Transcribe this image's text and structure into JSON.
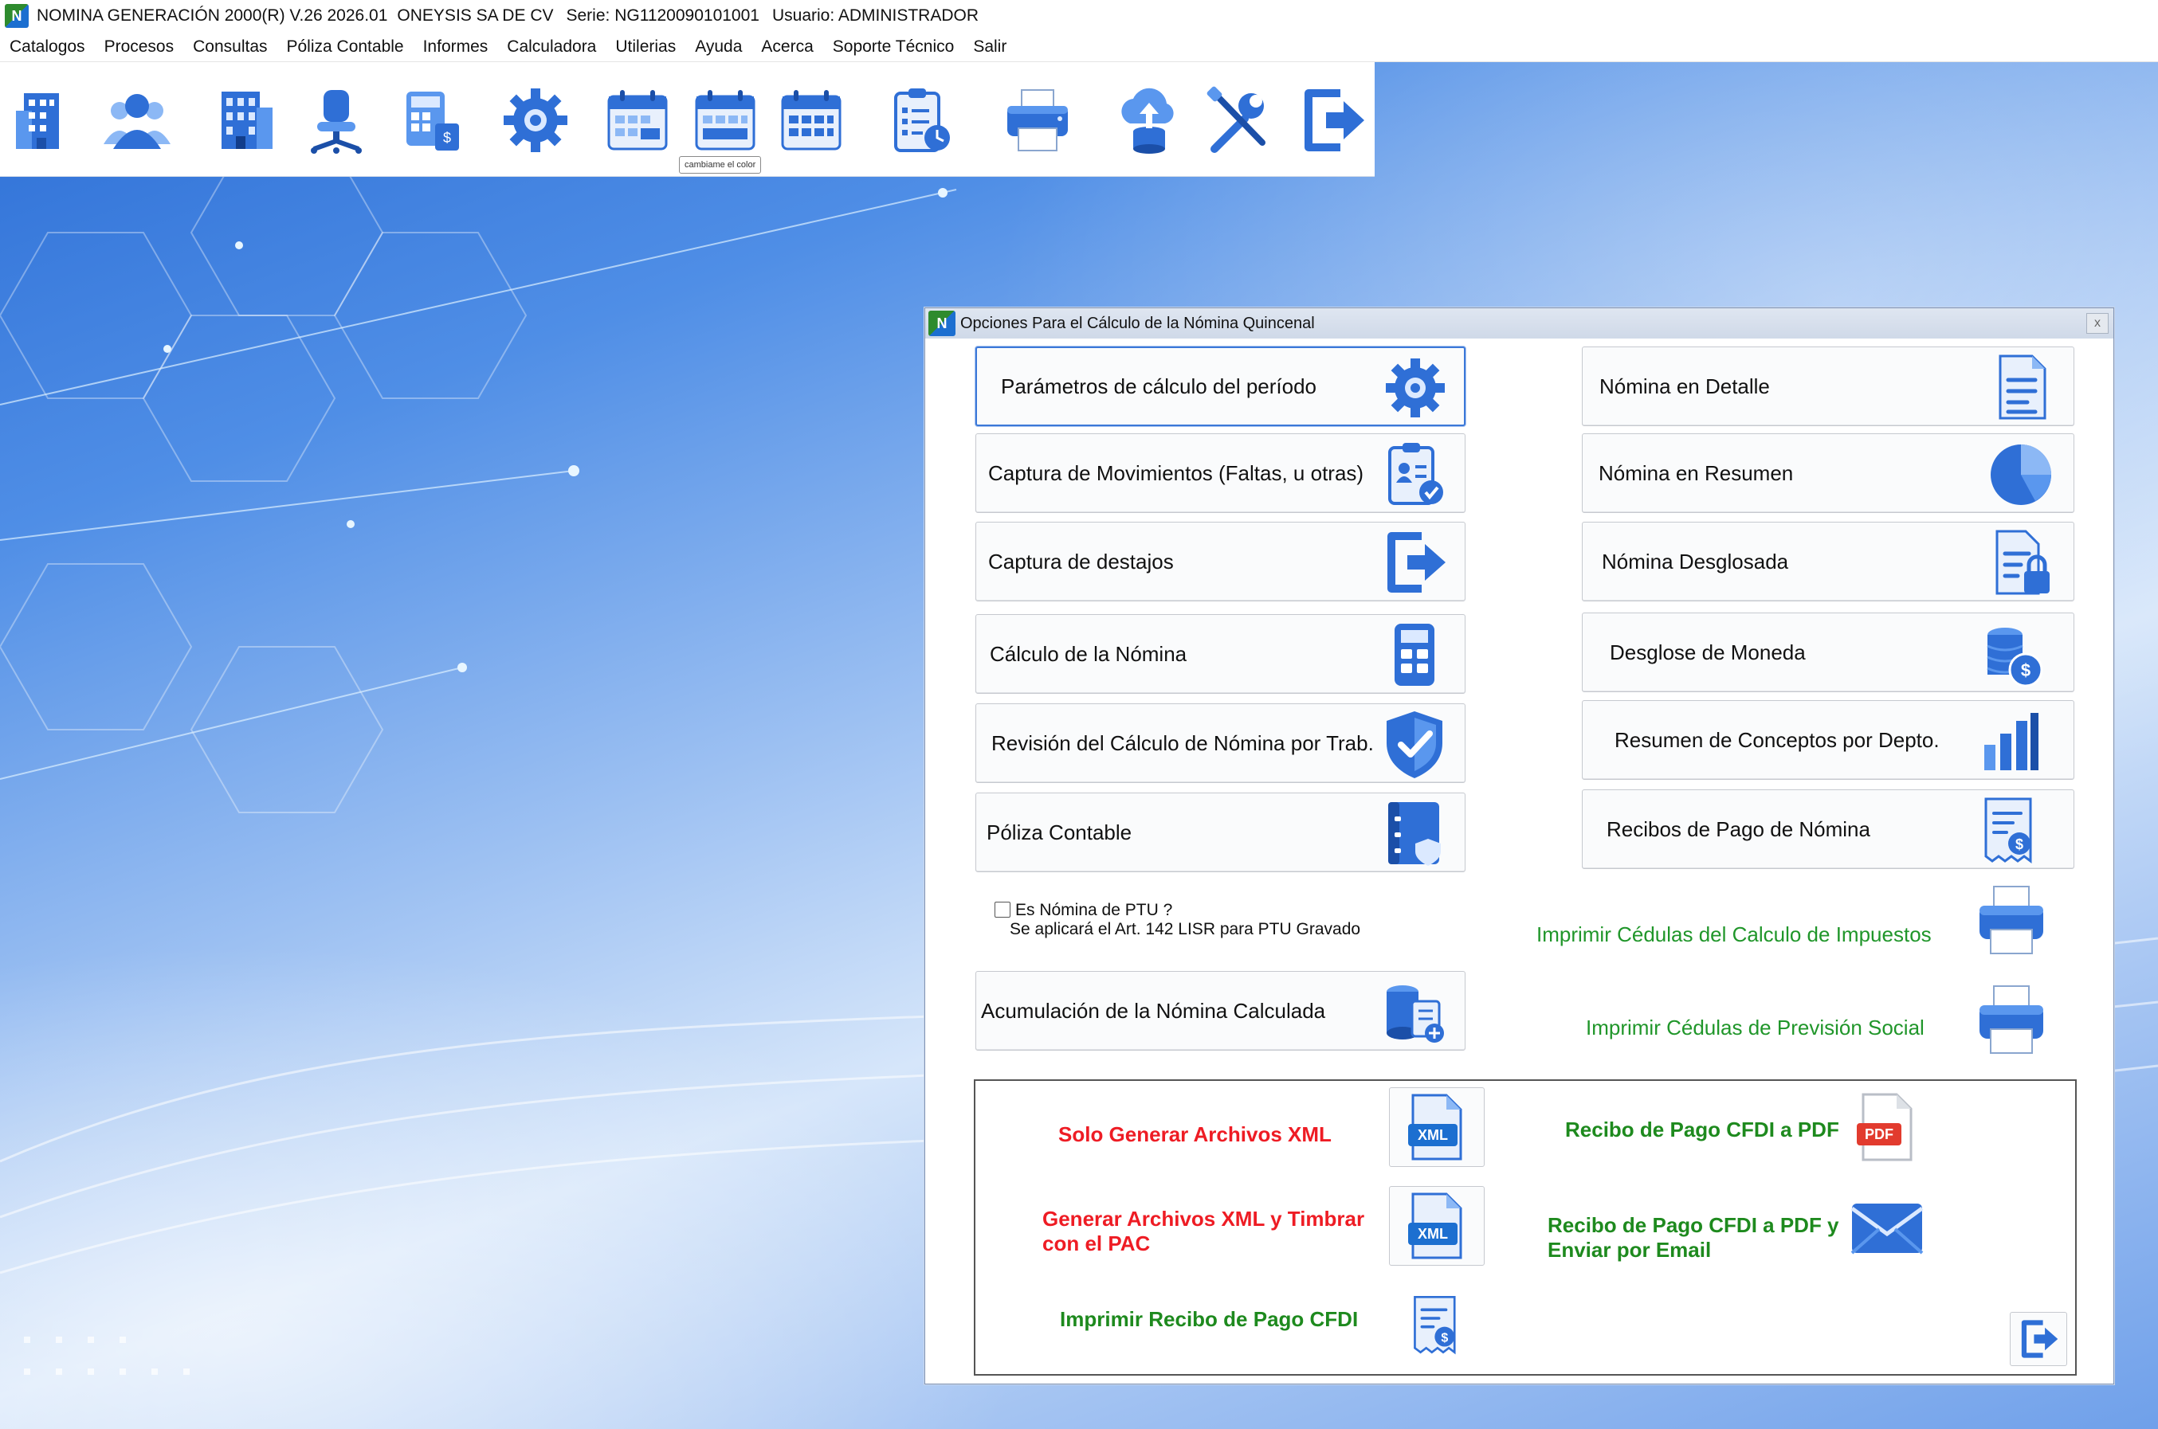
{
  "window": {
    "title_app": "NOMINA GENERACIÓN 2000(R) V.26 2026.01",
    "title_company": "ONEYSIS SA DE CV",
    "title_serie": "Serie: NG1120090101001",
    "title_user": "Usuario: ADMINISTRADOR"
  },
  "menu": [
    "Catalogos",
    "Procesos",
    "Consultas",
    "Póliza Contable",
    "Informes",
    "Calculadora",
    "Utilerias",
    "Ayuda",
    "Acerca",
    "Soporte Técnico",
    "Salir"
  ],
  "toolbar": {
    "icons": [
      "company-building-icon",
      "employees-icon",
      "departments-building-icon",
      "office-chair-icon",
      "calculator-money-icon",
      "gear-icon",
      "calendar-icon",
      "calendar-icon",
      "calendar-icon",
      "clipboard-clock-icon",
      "printer-icon",
      "cloud-upload-database-icon",
      "tools-icon",
      "exit-icon"
    ],
    "tooltip": "cambiame el color"
  },
  "dialog": {
    "title": "Opciones Para el Cálculo de la Nómina Quincenal",
    "close": "x",
    "left_buttons": [
      "Parámetros de cálculo del período",
      "Captura de Movimientos (Faltas, u otras)",
      "Captura de destajos",
      "Cálculo de la Nómina",
      "Revisión del Cálculo de Nómina por Trab.",
      "Póliza Contable"
    ],
    "right_buttons": [
      "Nómina en Detalle",
      "Nómina en Resumen",
      "Nómina Desglosada",
      "Desglose de Moneda",
      "Resumen de Conceptos por Depto.",
      "Recibos de Pago de Nómina"
    ],
    "ptu_checkbox": {
      "label": "Es Nómina de PTU ?",
      "note": "Se aplicará el Art. 142 LISR para PTU Gravado",
      "checked": false
    },
    "accumulate_button": "Acumulación de la Nómina Calculada",
    "print_links": [
      "Imprimir Cédulas del Calculo de Impuestos",
      "Imprimir Cédulas de Previsión Social"
    ],
    "cfdi": {
      "xml_only": "Solo Generar Archivos XML",
      "xml_stamp_line1": "Generar Archivos XML y Timbrar",
      "xml_stamp_line2": "con el PAC",
      "print_receipt": "Imprimir Recibo de Pago CFDI",
      "to_pdf": "Recibo de Pago CFDI a PDF",
      "pdf_email_line1": "Recibo de Pago CFDI a PDF y",
      "pdf_email_line2": "Enviar por Email",
      "xml_badge": "XML",
      "pdf_badge": "PDF"
    }
  },
  "colors": {
    "accent_blue": "#1c6fd0",
    "link_green": "#20962a",
    "cfdi_red": "#ee1c24"
  }
}
